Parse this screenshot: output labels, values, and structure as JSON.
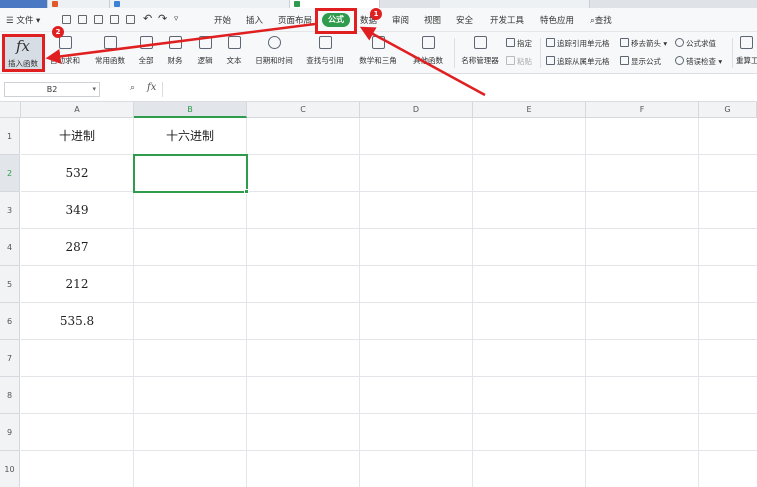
{
  "menu": {
    "file_label": "文件",
    "tabs": [
      {
        "label": "开始"
      },
      {
        "label": "插入"
      },
      {
        "label": "页面布局"
      },
      {
        "label": "公式",
        "active": true
      },
      {
        "label": "数据"
      },
      {
        "label": "审阅"
      },
      {
        "label": "视图"
      },
      {
        "label": "安全"
      },
      {
        "label": "开发工具"
      },
      {
        "label": "特色应用"
      }
    ],
    "search_label": "查找",
    "quick_access_icons": [
      "new-file-icon",
      "open-folder-icon",
      "save-icon",
      "print-icon",
      "print-preview-icon",
      "undo-icon",
      "redo-icon",
      "customize-icon"
    ]
  },
  "ribbon": {
    "insert_function": {
      "symbol": "fx",
      "label": "插入函数"
    },
    "buttons": [
      {
        "label": "自动求和",
        "icon": "sum-icon"
      },
      {
        "label": "常用函数",
        "icon": "star-function-icon"
      },
      {
        "label": "全部",
        "icon": "all-functions-icon"
      },
      {
        "label": "财务",
        "icon": "finance-icon"
      },
      {
        "label": "逻辑",
        "icon": "logic-icon"
      },
      {
        "label": "文本",
        "icon": "text-icon"
      },
      {
        "label": "日期和时间",
        "icon": "clock-icon"
      },
      {
        "label": "查找与引用",
        "icon": "lookup-icon"
      },
      {
        "label": "数学和三角",
        "icon": "math-icon"
      },
      {
        "label": "其他函数",
        "icon": "more-functions-icon"
      },
      {
        "label": "名称管理器",
        "icon": "name-manager-icon"
      }
    ],
    "name_small": [
      {
        "label": "指定"
      },
      {
        "label": "粘贴"
      }
    ],
    "audit_small": [
      {
        "label": "追踪引用单元格"
      },
      {
        "label": "移去箭头"
      },
      {
        "label": "公式求值"
      },
      {
        "label": "追踪从属单元格"
      },
      {
        "label": "显示公式"
      },
      {
        "label": "错误检查"
      }
    ],
    "recalc_label": "重算工"
  },
  "formula_bar": {
    "name_box": "B2",
    "fx_label": "fx",
    "value": ""
  },
  "sheet": {
    "columns": [
      "A",
      "B",
      "C",
      "D",
      "E",
      "F",
      "G"
    ],
    "rows": [
      "1",
      "2",
      "3",
      "4",
      "5",
      "6",
      "7",
      "8",
      "9",
      "10"
    ],
    "selected_cell": "B2",
    "cells": {
      "A1": "十进制",
      "B1": "十六进制",
      "A2": "532",
      "A3": "349",
      "A4": "287",
      "A5": "212",
      "A6": "535.8"
    }
  },
  "annotations": {
    "badge_1": "1",
    "badge_2": "2",
    "color": "#e02020"
  },
  "colors": {
    "accent": "#2e9c4c",
    "highlight": "#e02020"
  }
}
